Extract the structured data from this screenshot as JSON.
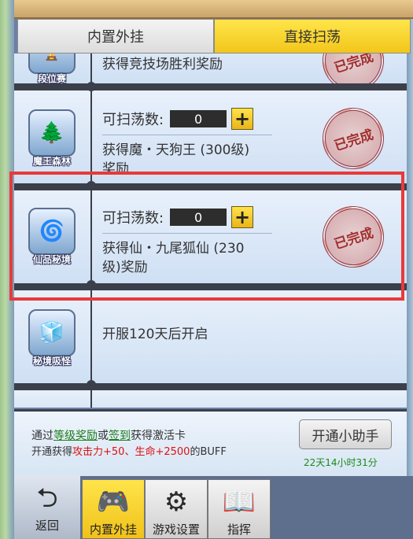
{
  "tabs": [
    {
      "label": "内置外挂",
      "active": false
    },
    {
      "label": "直接扫荡",
      "active": true
    }
  ],
  "rows": [
    {
      "badge_label": "段位赛",
      "badge_icon": "trophy-icon",
      "reward": "获得竞技场胜利奖励",
      "stamp": "已完成"
    },
    {
      "badge_label": "魔王森林",
      "badge_icon": "forest-icon",
      "sweep_label": "可扫荡数:",
      "count": "0",
      "reward_line1": "获得魔・天狗王 (300级)",
      "reward_line2": "奖励",
      "stamp": "已完成"
    },
    {
      "badge_label": "仙品秘境",
      "badge_icon": "portal-icon",
      "sweep_label": "可扫荡数:",
      "count": "0",
      "reward_line1": "获得仙・九尾狐仙 (230",
      "reward_line2": "级)奖励",
      "stamp": "已完成"
    },
    {
      "badge_label": "秘境吸怪",
      "badge_icon": "cube-icon",
      "reward": "开服120天后开启"
    }
  ],
  "footer": {
    "line1_prefix": "通过",
    "line1_link1": "等级奖励",
    "line1_mid": "或",
    "line1_link2": "签到",
    "line1_suffix": "获得激活卡",
    "line2_prefix": "开通获得",
    "line2_red": "攻击力+50、生命+2500",
    "line2_suffix": "的BUFF",
    "assist_button": "开通小助手",
    "timer": "22天14小时31分"
  },
  "bottom_nav": [
    {
      "label": "返回",
      "icon": "back-arrow-icon"
    },
    {
      "label": "内置外挂",
      "icon": "gamepad-icon",
      "active": true
    },
    {
      "label": "游戏设置",
      "icon": "gamepad-gear-icon"
    },
    {
      "label": "指挥",
      "icon": "book-icon"
    }
  ],
  "colors": {
    "tab_active": "#f2c61b",
    "highlight_border": "#e83a3a",
    "stamp": "#9c1f1f",
    "timer": "#1a8a1a"
  }
}
